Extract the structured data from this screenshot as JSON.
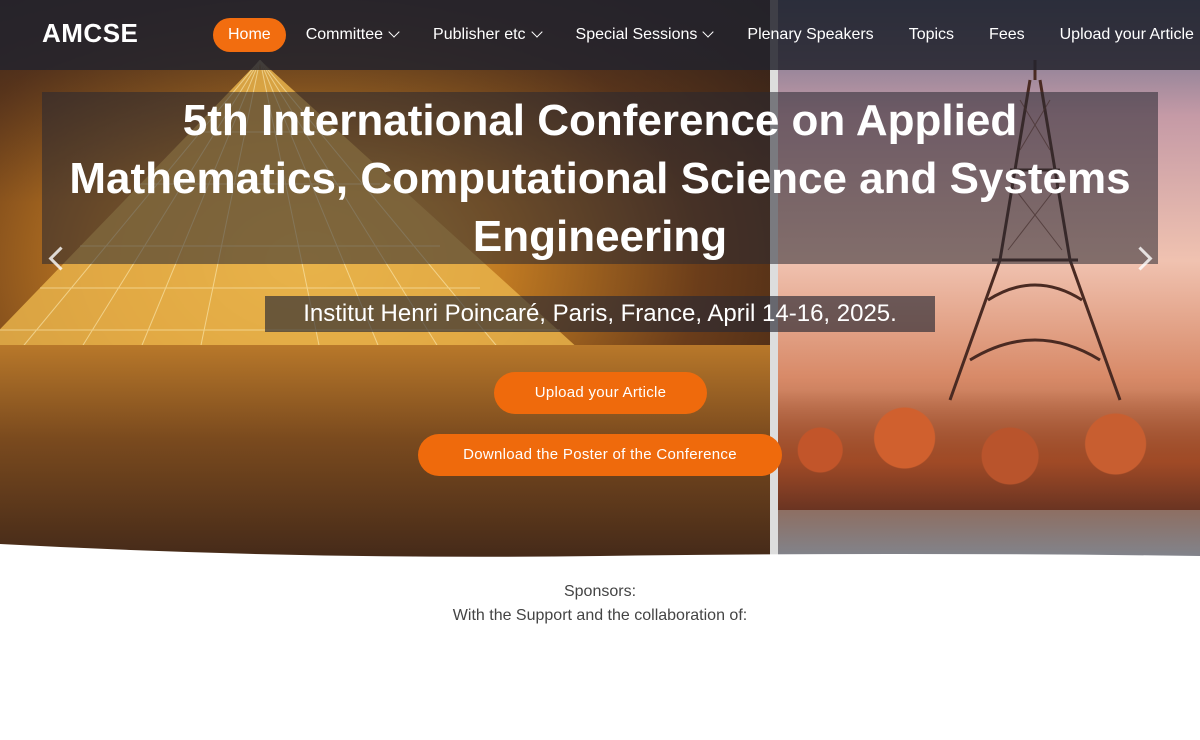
{
  "nav": {
    "logo": "AMCSE",
    "items": [
      {
        "label": "Home",
        "active": true,
        "dropdown": false
      },
      {
        "label": "Committee",
        "active": false,
        "dropdown": true
      },
      {
        "label": "Publisher etc",
        "active": false,
        "dropdown": true
      },
      {
        "label": "Special Sessions",
        "active": false,
        "dropdown": true
      },
      {
        "label": "Plenary Speakers",
        "active": false,
        "dropdown": false
      },
      {
        "label": "Topics",
        "active": false,
        "dropdown": false
      },
      {
        "label": "Fees",
        "active": false,
        "dropdown": false
      },
      {
        "label": "Upload your Article",
        "active": false,
        "dropdown": false
      }
    ]
  },
  "hero": {
    "title": "5th International Conference on Applied Mathematics, Computational Science and Systems Engineering",
    "subtitle": "Institut Henri Poincaré, Paris, France, April 14-16, 2025.",
    "upload_button": "Upload your Article",
    "poster_button": "Download the Poster of the Conference"
  },
  "sponsors": {
    "heading": "Sponsors:",
    "text": "With the Support and the collaboration of:"
  },
  "colors": {
    "accent": "#ef6a0c",
    "navbar": "#23232d"
  }
}
